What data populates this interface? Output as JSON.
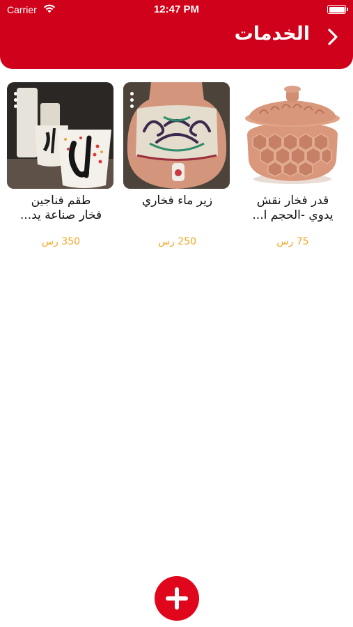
{
  "status_bar": {
    "carrier": "Carrier",
    "time": "12:47 PM"
  },
  "header": {
    "title": "الخدمات",
    "back_icon": "chevron-right-icon"
  },
  "products": [
    {
      "name_line1": "قدر فخار نقش",
      "name_line2": "يدوي -الحجم ا...",
      "price": "75 رس",
      "image": "clay-pot-with-lid"
    },
    {
      "name_line1": "زير ماء فخاري",
      "name_line2": "",
      "price": "250 رس",
      "image": "clay-water-jar"
    },
    {
      "name_line1": "طقم فناجين",
      "name_line2": "فخار صناعة يد...",
      "price": "350 رس",
      "image": "clay-cups-set"
    }
  ],
  "fab": {
    "icon": "plus-icon"
  },
  "colors": {
    "brand": "#d0021b",
    "price": "#f5a623",
    "fab": "#e0061c"
  }
}
